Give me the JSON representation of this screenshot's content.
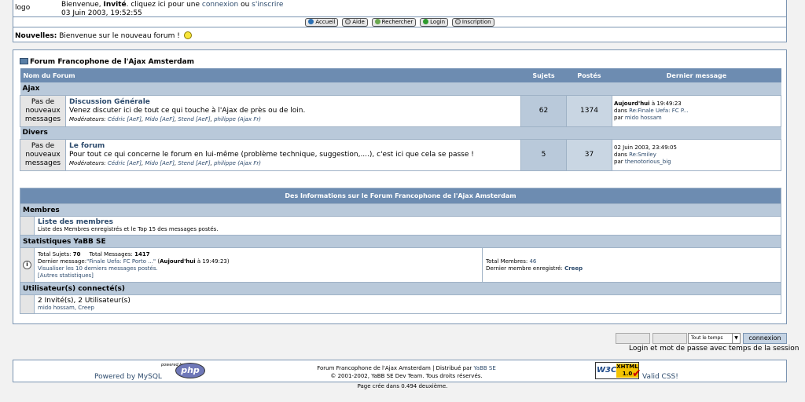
{
  "header": {
    "logo": "logo",
    "welcome_prefix": "Bienvenue,",
    "welcome_user": "Invité",
    "welcome_mid": ". cliquez ici pour une",
    "login_link": "connexion",
    "welcome_or": "ou",
    "register_link": "s'inscrire",
    "datetime": "03 Juin 2003, 19:52:55"
  },
  "nav": [
    {
      "label": "Accueil",
      "icon": "home-icon",
      "color": "#2a6fb4"
    },
    {
      "label": "Aide",
      "icon": "help-icon",
      "color": "#cccccc"
    },
    {
      "label": "Rechercher",
      "icon": "search-icon",
      "color": "#6aa84f"
    },
    {
      "label": "Login",
      "icon": "login-icon",
      "color": "#2e9b2e"
    },
    {
      "label": "Inscription",
      "icon": "register-icon",
      "color": "#cccccc"
    }
  ],
  "news": {
    "label": "Nouvelles:",
    "text": "Bienvenue sur le nouveau forum !"
  },
  "forum": {
    "title": "Forum Francophone de l'Ajax Amsterdam",
    "columns": {
      "name": "Nom du Forum",
      "topics": "Sujets",
      "posts": "Postés",
      "last": "Dernier message"
    },
    "categories": [
      {
        "name": "Ajax",
        "board": {
          "status": "Pas de nouveaux messages",
          "name": "Discussion Générale",
          "desc": "Venez discuter ici de tout ce qui touche à l'Ajax de près ou de loin.",
          "mods_label": "Modérateurs:",
          "mods": [
            "Cédric [AeF]",
            "Mido [AeF]",
            "Stend [AeF]",
            "philippe (Ajax Fr)"
          ],
          "topics": "62",
          "posts": "1374",
          "last_date_bold": "Aujourd'hui",
          "last_date": "à 19:49:23",
          "last_in": "dans",
          "last_topic": "Re:Finale Uefa: FC P...",
          "last_by": "par",
          "last_user": "mido hossam"
        }
      },
      {
        "name": "Divers",
        "board": {
          "status": "Pas de nouveaux messages",
          "name": "Le forum",
          "desc": "Pour tout ce qui concerne le forum en lui-même (problème technique, suggestion,....), c'est ici que cela se passe !",
          "mods_label": "Modérateurs:",
          "mods": [
            "Cédric [AeF]",
            "Mido [AeF]",
            "Stend [AeF]",
            "philippe (Ajax Fr)"
          ],
          "topics": "5",
          "posts": "37",
          "last_date_bold": "",
          "last_date": "02 Juin 2003, 23:49:05",
          "last_in": "dans",
          "last_topic": "Re:Smiley",
          "last_by": "par",
          "last_user": "thenotorious_big"
        }
      }
    ]
  },
  "info": {
    "title": "Des Informations sur le Forum Francophone de l'Ajax Amsterdam",
    "members_cat": "Membres",
    "members_link": "Liste des membres",
    "members_desc": "Liste des Membres enregistrés et le Top 15 des messages postés.",
    "stats_cat": "Statistiques YaBB SE",
    "total_topics_label": "Total Sujets:",
    "total_topics": "70",
    "total_messages_label": "Total Messages:",
    "total_messages": "1417",
    "last_msg_label": "Dernier message:",
    "last_msg_link": "\"Finale Uefa: FC Porto ...\"",
    "last_msg_when_bold": "Aujourd'hui",
    "last_msg_when": "à 19:49:23",
    "view_last10": "Visualiser les 10 derniers messages postés.",
    "other_stats": "[Autres statistiques]",
    "total_members_label": "Total Membres:",
    "total_members": "46",
    "last_member_label": "Dernier membre enregistré:",
    "last_member": "Creep",
    "online_cat": "Utilisateur(s) connecté(s)",
    "online_count": "2 Invité(s), 2 Utilisateur(s)",
    "online_users": "mido hossam, Creep"
  },
  "login": {
    "session_select": "Tout le temps",
    "button": "connexion",
    "caption": "Login et mot de passe avec temps de la session"
  },
  "footer": {
    "powered_mysql": "Powered by MySQL",
    "php_small": "powered by",
    "php_logo": "php",
    "copyright_line1": "Forum Francophone de l'Ajax Amsterdam | Distribué par",
    "yabb_link": "YaBB SE",
    "copyright_line2": "© 2001-2002, YaBB SE Dev Team. Tous droits réservés.",
    "w3c_a": "W3C",
    "w3c_b": "XHTML 1.0",
    "valid_css": "Valid CSS!",
    "page_time": "Page crée dans 0.494 deuxième."
  }
}
